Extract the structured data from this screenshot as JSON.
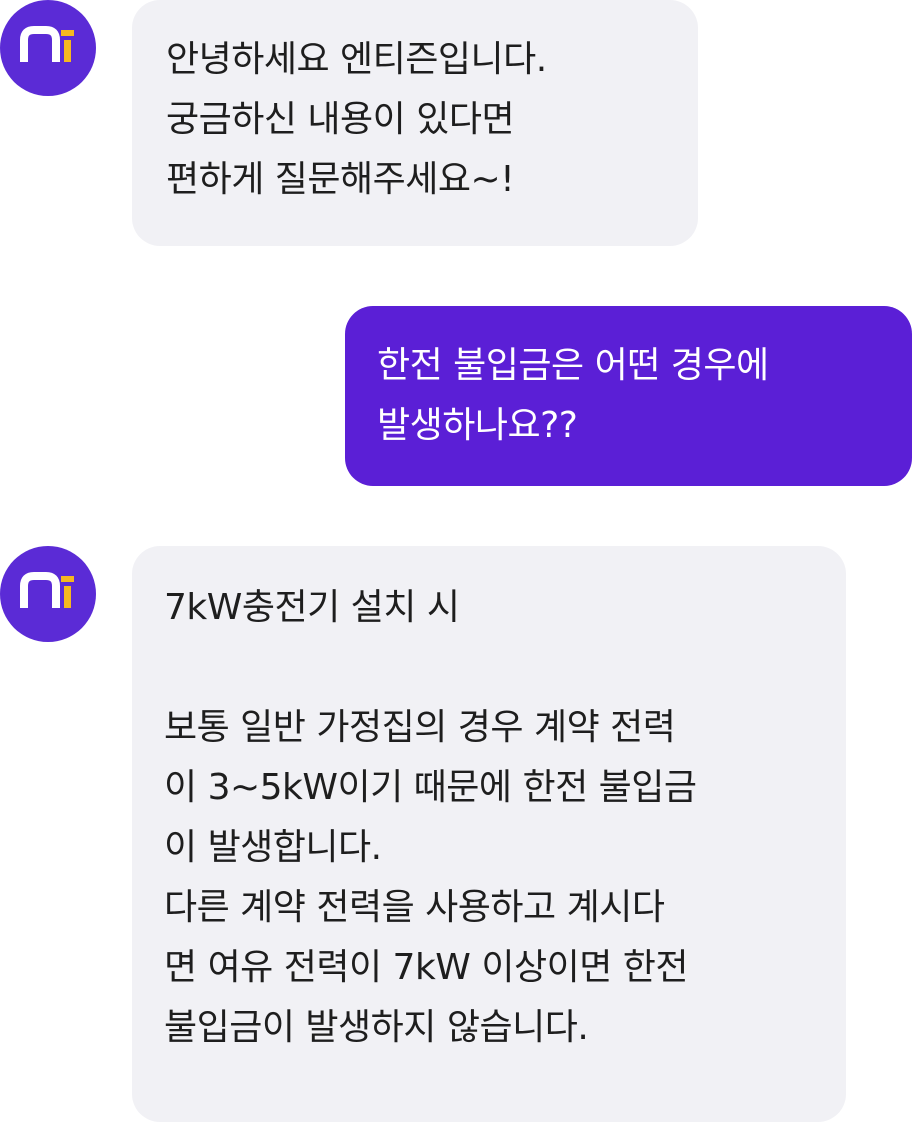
{
  "conversation": {
    "messages": [
      {
        "sender": "bot",
        "avatar_icon": "entizen-logo-icon",
        "text": "안녕하세요 엔티즌입니다.\n궁금하신 내용이 있다면\n편하게 질문해주세요~!"
      },
      {
        "sender": "user",
        "text": "한전 불입금은 어떤 경우에\n발생하나요??"
      },
      {
        "sender": "bot",
        "avatar_icon": "entizen-logo-icon",
        "text": "7kW충전기 설치 시\n\n보통 일반 가정집의 경우 계약 전력\n이 3~5kW이기 때문에 한전 불입금\n이 발생합니다.\n다른 계약 전력을 사용하고 계시다\n면 여유 전력이 7kW 이상이면 한전\n불입금이 발생하지 않습니다."
      }
    ]
  },
  "colors": {
    "avatar_bg": "#5b2bd6",
    "avatar_accent": "#f5b820",
    "bot_bubble_bg": "#f1f1f5",
    "user_bubble_bg": "#5b1fd6"
  }
}
